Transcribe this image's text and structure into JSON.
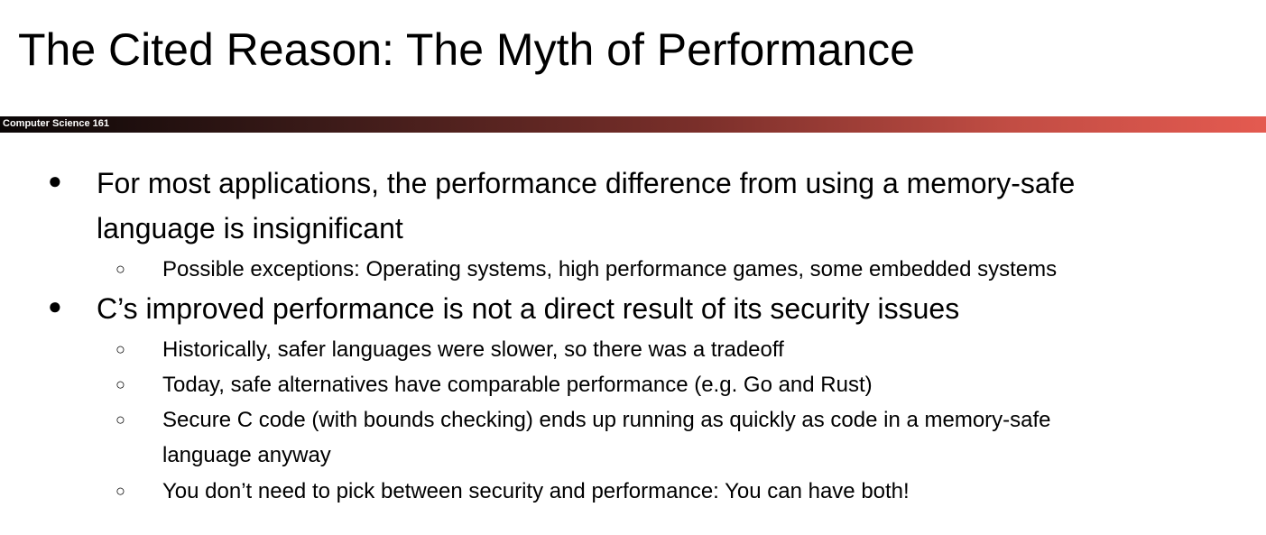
{
  "title": "The Cited Reason: The Myth of Performance",
  "course_label": "Computer Science 161",
  "bullets": [
    {
      "text": "For most applications, the performance difference from using a memory-safe",
      "text2": "language is insignificant",
      "sub": [
        "Possible exceptions: Operating systems, high performance games, some embedded systems"
      ]
    },
    {
      "text": "C’s improved performance is not a direct result of its security issues",
      "sub": [
        "Historically, safer languages were slower, so there was a tradeoff",
        "Today, safe alternatives have comparable performance (e.g. Go and Rust)",
        "Secure C code (with bounds checking) ends up running as quickly as code in a memory-safe",
        "language anyway",
        "You don’t need to pick between security and performance: You can have both!"
      ]
    }
  ],
  "bullet1": "●",
  "bullet2": "○"
}
